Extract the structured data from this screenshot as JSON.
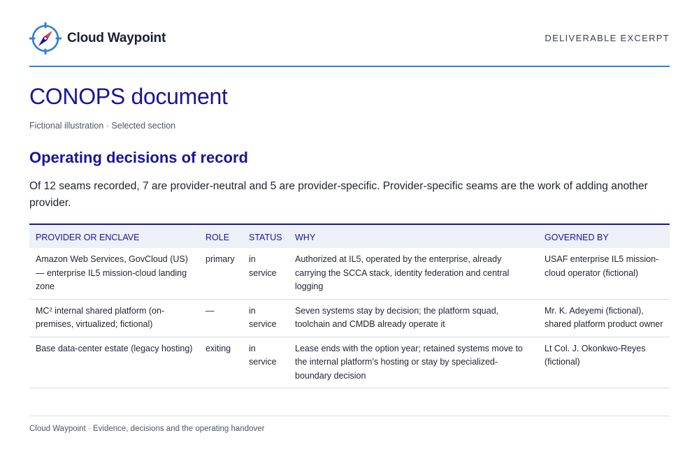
{
  "header": {
    "brand_name": "Cloud Waypoint",
    "label": "DELIVERABLE EXCERPT",
    "logo_icon": "compass-icon"
  },
  "document": {
    "title": "CONOPS document",
    "subtitle": "Fictional illustration · Selected section",
    "section_title": "Operating decisions of record",
    "intro": "Of 12 seams recorded, 7 are provider-neutral and 5 are provider-specific. Provider-specific seams are the work of adding another provider."
  },
  "table": {
    "headers": [
      "PROVIDER OR ENCLAVE",
      "ROLE",
      "STATUS",
      "WHY",
      "GOVERNED BY"
    ],
    "rows": [
      [
        "Amazon Web Services, GovCloud (US) — enterprise IL5 mission-cloud landing zone",
        "primary",
        "in service",
        "Authorized at IL5, operated by the enterprise, already carrying the SCCA stack, identity federation and central logging",
        "USAF enterprise IL5 mission-cloud operator (fictional)"
      ],
      [
        "MC² internal shared platform (on-premises, virtualized; fictional)",
        "—",
        "in service",
        "Seven systems stay by decision; the platform squad, toolchain and CMDB already operate it",
        "Mr. K. Adeyemi (fictional), shared platform product owner"
      ],
      [
        "Base data-center estate (legacy hosting)",
        "exiting",
        "in service",
        "Lease ends with the option year; retained systems move to the internal platform's hosting or stay by specialized-boundary decision",
        "Lt Col. J. Okonkwo-Reyes (fictional)"
      ]
    ]
  },
  "footer": {
    "text": "Cloud Waypoint · Evidence, decisions and the operating handover"
  },
  "colors": {
    "accent": "#1a1596",
    "rule": "#2f7fd8",
    "header_bg": "#eef0f8"
  }
}
